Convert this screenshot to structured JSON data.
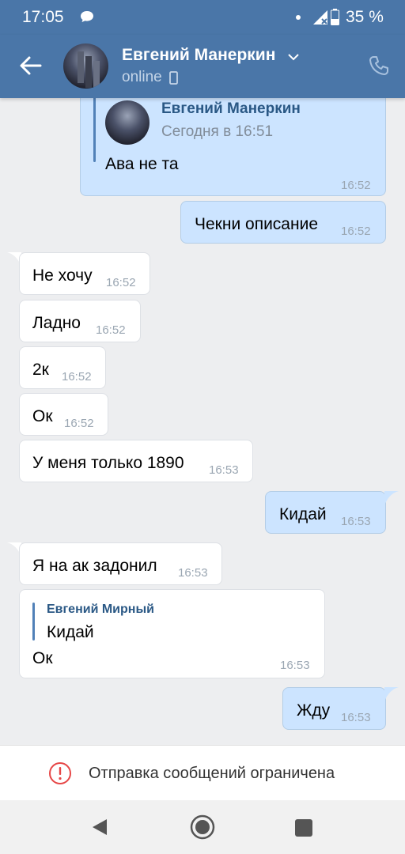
{
  "status_bar": {
    "time": "17:05",
    "battery_pct": "35 %"
  },
  "header": {
    "name": "Евгений Манеркин",
    "status": "online"
  },
  "messages": {
    "m1": {
      "reply_name": "Евгений Манеркин",
      "reply_time": "Сегодня в 16:51",
      "text": "Ава не та",
      "time": "16:52"
    },
    "m2": {
      "text": "Чекни описание",
      "time": "16:52"
    },
    "m3": {
      "text": "Не хочу",
      "time": "16:52"
    },
    "m4": {
      "text": "Ладно",
      "time": "16:52"
    },
    "m5": {
      "text": "2к",
      "time": "16:52"
    },
    "m6": {
      "text": "Ок",
      "time": "16:52"
    },
    "m7": {
      "text": "У меня только 1890",
      "time": "16:53"
    },
    "m8": {
      "text": "Кидай",
      "time": "16:53"
    },
    "m9": {
      "text": "Я на ак задонил",
      "time": "16:53"
    },
    "m10": {
      "reply_name": "Евгений Мирный",
      "reply_text": "Кидай",
      "text": "Ок",
      "time": "16:53"
    },
    "m11": {
      "text": "Жду",
      "time": "16:53"
    }
  },
  "restriction": {
    "text": "Отправка сообщений ограничена"
  },
  "colors": {
    "accent": "#4a76a8",
    "outgoing_bubble": "#cce4ff",
    "incoming_bubble": "#ffffff",
    "warning": "#e64646"
  }
}
